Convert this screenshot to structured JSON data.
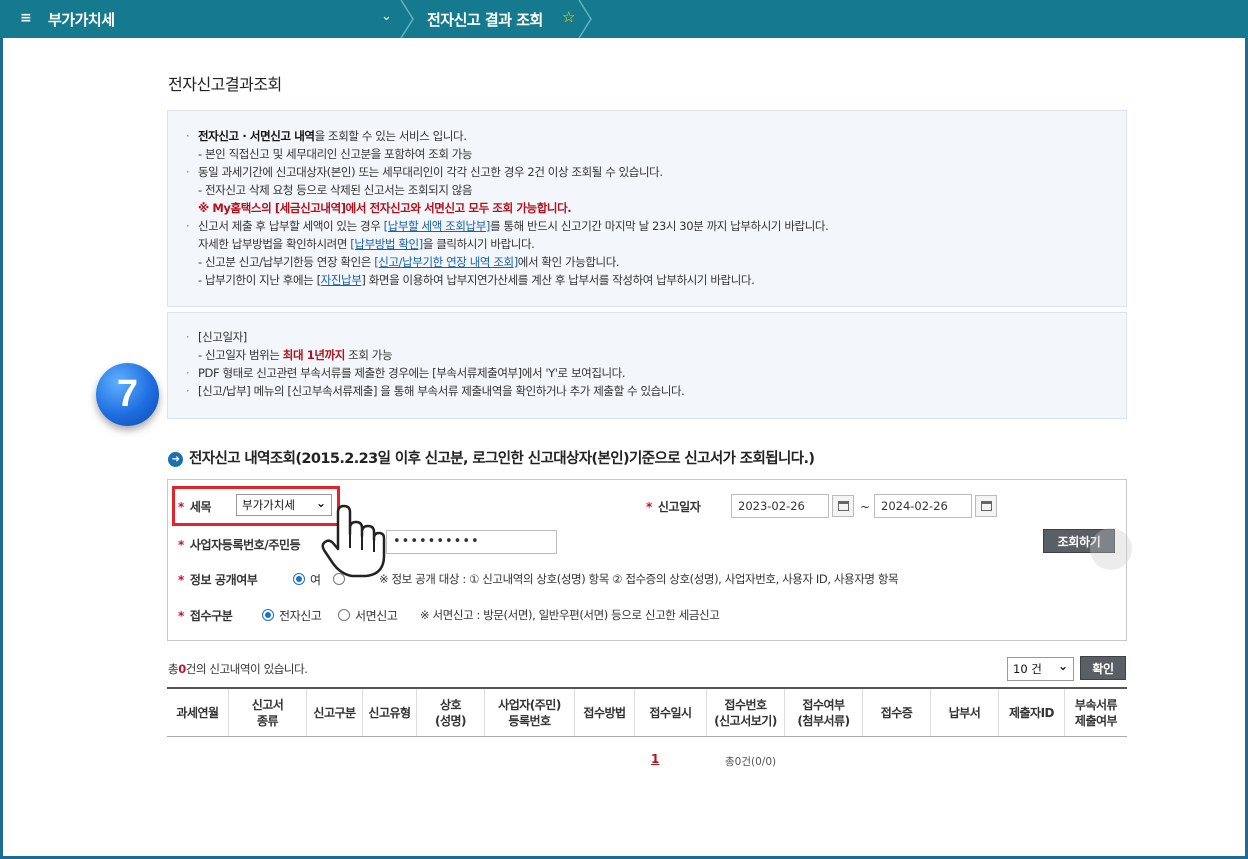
{
  "topbar": {
    "menu_icon": "≡",
    "section": "부가가치세",
    "page": "전자신고 결과 조회"
  },
  "page_title": "전자신고결과조회",
  "info1": {
    "l1_bold": "전자신고 · 서면신고 내역",
    "l1_rest": "을 조회할 수 있는 서비스 입니다.",
    "l2": "- 본인 직접신고 및 세무대리인 신고분을 포함하여 조회 가능",
    "l3": "동일 과세기간에 신고대상자(본인) 또는 세무대리인이 각각 신고한 경우 2건 이상 조회될 수 있습니다.",
    "l4": "- 전자신고 삭제 요청 등으로 삭제된 신고서는 조회되지 않음",
    "l5": "※ My홈택스의 [세금신고내역]에서 전자신고와 서면신고 모두 조회 가능합니다.",
    "l6a": "신고서 제출 후 납부할 세액이 있는 경우 ",
    "l6_link": "[납부할 세액 조회납부]",
    "l6b": "를 통해 반드시 신고기간 마지막 날 23시 30분 까지 납부하시기 바랍니다.",
    "l7a": "자세한 납부방법을 확인하시려면 ",
    "l7_link": "[납부방법 확인]",
    "l7b": "을 클릭하시기 바랍니다.",
    "l8a": "- 신고분 신고/납부기한등 연장 확인은 ",
    "l8_link": "[신고/납부기한 연장 내역 조회]",
    "l8b": "에서 확인 가능합니다.",
    "l9a": "- 납부기한이 지난 후에는 [",
    "l9_link": "자진납부",
    "l9b": "] 화면을 이용하여 납부지연가산세를 계산 후 납부서를 작성하여 납부하시기 바랍니다."
  },
  "info2": {
    "l1": "[신고일자]",
    "l2a": "- 신고일자 범위는 ",
    "l2_red": "최대 1년까지",
    "l2b": " 조회 가능",
    "l3": "PDF 형태로 신고관련 부속서류를 제출한 경우에는 [부속서류제출여부]에서 'Y'로 보여집니다.",
    "l4": "[신고/납부] 메뉴의 [신고부속서류제출] 을 통해 부속서류 제출내역을 확인하거나 추가 제출할 수 있습니다."
  },
  "step_number": "7",
  "query_heading": "전자신고 내역조회(2015.2.23일 이후 신고분, 로그인한  신고대상자(본인)기준으로  신고서가 조회됩니다.)",
  "form": {
    "tax_label": "세목",
    "tax_value": "부가가치세",
    "date_label": "신고일자",
    "date_from": "2023-02-26",
    "date_to": "2024-02-26",
    "tilde": "~",
    "biz_label": "사업자등록번호/주민등",
    "biz_value": "••••••••••",
    "search_button": "조회하기",
    "disclose_label": "정보 공개여부",
    "disclose_yes": "여",
    "disclose_note": "※ 정보 공개 대상 : ① 신고내역의 상호(성명) 항목 ② 접수증의 상호(성명), 사업자번호, 사용자 ID, 사용자명 항목",
    "receipt_label": "접수구분",
    "receipt_opt1": "전자신고",
    "receipt_opt2": "서면신고",
    "receipt_note": "※ 서면신고 : 방문(서면), 일반우편(서면) 등으로 신고한 세금신고"
  },
  "results": {
    "count_prefix": "총",
    "count_num": "0",
    "count_suffix": "건의 신고내역이 있습니다.",
    "page_size": "10 건",
    "confirm_button": "확인",
    "columns": [
      "과세연월",
      "신고서\n종류",
      "신고구분",
      "신고유형",
      "상호\n(성명)",
      "사업자(주민)\n등록번호",
      "접수방법",
      "접수일시",
      "접수번호\n(신고서보기)",
      "접수여부\n(첨부서류)",
      "접수증",
      "납부서",
      "제출자ID",
      "부속서류\n제출여부"
    ],
    "page": "1",
    "total": "총0건(0/0)"
  },
  "colors": {
    "topbar": "#157a8d",
    "accent_red": "#c8102e",
    "highlight": "#e3242b",
    "badge_blue": "#1f6ee0"
  }
}
